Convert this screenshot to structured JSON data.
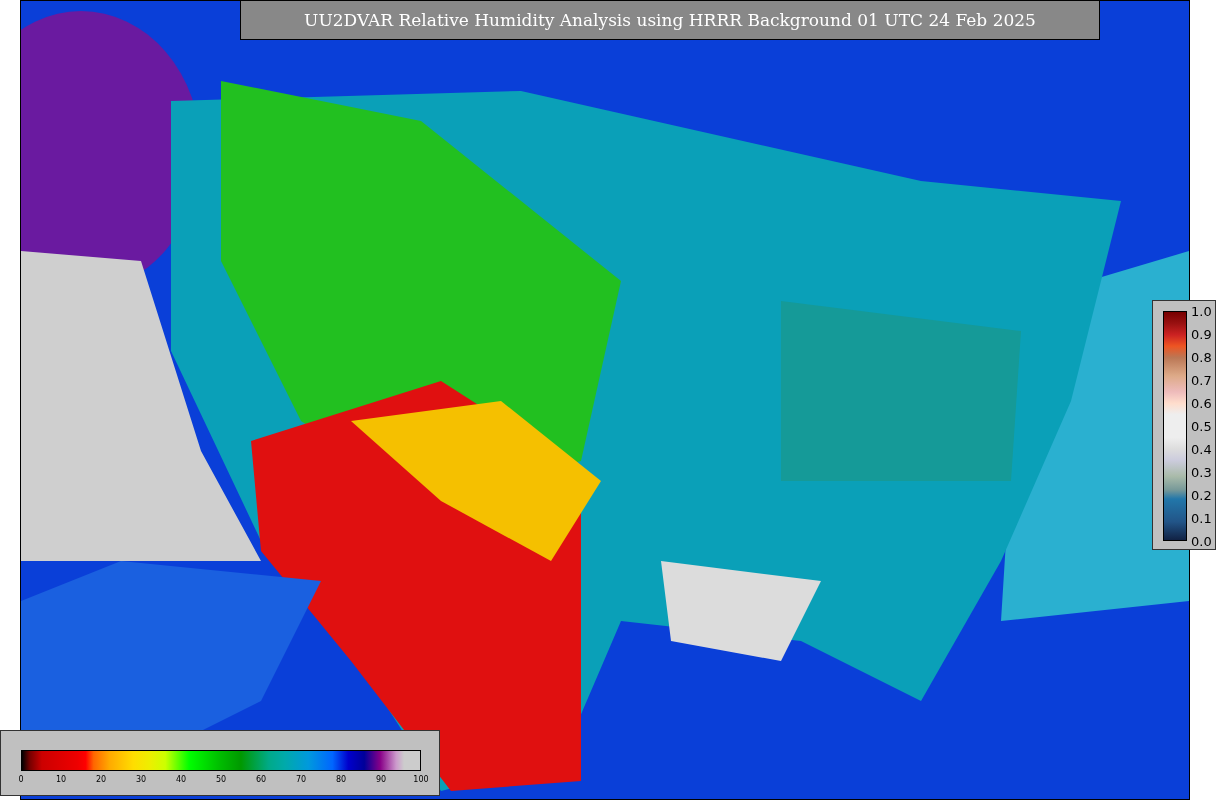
{
  "title": "UU2DVAR Relative Humidity Analysis using HRRR Background 01 UTC 24 Feb 2025",
  "humidity_colorbar": {
    "ticks": [
      "0",
      "10",
      "20",
      "30",
      "40",
      "50",
      "60",
      "70",
      "80",
      "90",
      "100"
    ]
  },
  "weight_colorbar": {
    "ticks": [
      "1.0",
      "0.9",
      "0.8",
      "0.7",
      "0.6",
      "0.5",
      "0.4",
      "0.3",
      "0.2",
      "0.1",
      "0.0"
    ]
  }
}
